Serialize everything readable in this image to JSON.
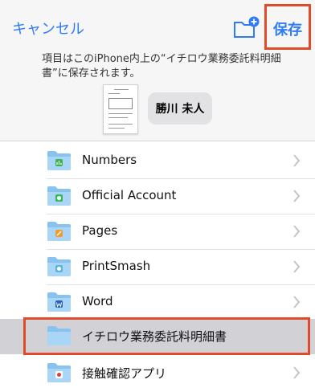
{
  "header": {
    "cancel_label": "キャンセル",
    "save_label": "保存",
    "message": "項目はこのiPhone内上の“イチロウ業務委託料明細書”に保存されます。",
    "name_label": "勝川 未人"
  },
  "folders": [
    {
      "name": "Numbers",
      "icon": "numbers-app-icon",
      "selected": false
    },
    {
      "name": "Official Account",
      "icon": "line-official-icon",
      "selected": false
    },
    {
      "name": "Pages",
      "icon": "pages-app-icon",
      "selected": false
    },
    {
      "name": "PrintSmash",
      "icon": "printsmash-app-icon",
      "selected": false
    },
    {
      "name": "Word",
      "icon": "word-app-icon",
      "selected": false
    },
    {
      "name": "イチロウ業務委託料明細書",
      "icon": "folder-icon",
      "selected": true
    },
    {
      "name": "接触確認アプリ",
      "icon": "cocoa-app-icon",
      "selected": false
    }
  ],
  "colors": {
    "accent": "#2f7cf6",
    "highlight_frame": "#e04b2c",
    "folder_light": "#a9d6f7",
    "folder_dark": "#88c2ee",
    "selected_row": "#d1d1d6"
  }
}
